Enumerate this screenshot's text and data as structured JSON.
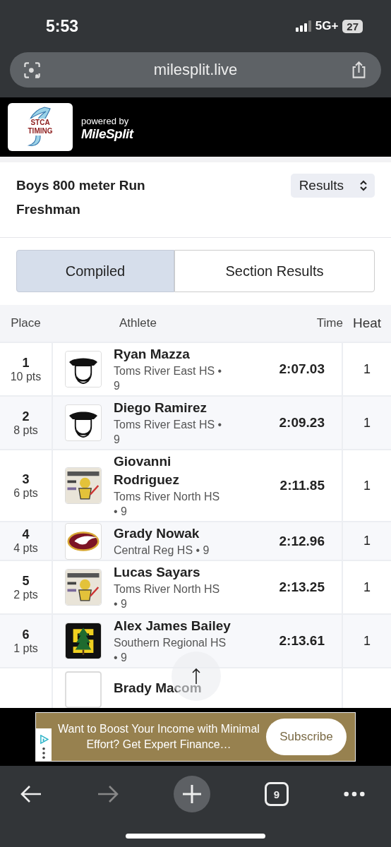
{
  "status_bar": {
    "time": "5:53",
    "network": "5G+",
    "battery": "27"
  },
  "browser": {
    "url": "milesplit.live",
    "tab_count": "9"
  },
  "header": {
    "logo_text": [
      "STCA",
      "TIMING"
    ],
    "powered_by": "powered by",
    "brand": "MileSplit"
  },
  "event": {
    "title": "Boys 800 meter Run",
    "subtitle": "Freshman",
    "view_select": "Results"
  },
  "tabs": [
    {
      "label": "Compiled",
      "selected": true
    },
    {
      "label": "Section Results",
      "selected": false
    }
  ],
  "table": {
    "columns": [
      "Place",
      "Athlete",
      "Time",
      "Heat"
    ],
    "rows": [
      {
        "place": "1",
        "points": "10 pts",
        "logo": {
          "kind": "pirate"
        },
        "name": "Ryan Mazza",
        "team": "Toms River East HS •",
        "grade": "9",
        "time": "2:07.03",
        "heat": "1"
      },
      {
        "place": "2",
        "points": "8 pts",
        "logo": {
          "kind": "pirate"
        },
        "name": "Diego Ramirez",
        "team": "Toms River East HS •",
        "grade": "9",
        "time": "2:09.23",
        "heat": "1"
      },
      {
        "place": "3",
        "points": "6 pts",
        "logo": {
          "kind": "north"
        },
        "name": "Giovanni Rodriguez",
        "team": "Toms River North HS",
        "grade": "• 9",
        "time": "2:11.85",
        "heat": "1"
      },
      {
        "place": "4",
        "points": "4 pts",
        "logo": {
          "kind": "eagle"
        },
        "name": "Grady Nowak",
        "team": "Central Reg HS • 9",
        "time": "2:12.96",
        "heat": "1"
      },
      {
        "place": "5",
        "points": "2 pts",
        "logo": {
          "kind": "north"
        },
        "name": "Lucas Sayars",
        "team": "Toms River North HS",
        "grade": "• 9",
        "time": "2:13.25",
        "heat": "1"
      },
      {
        "place": "6",
        "points": "1 pts",
        "logo": {
          "kind": "tree"
        },
        "name": "Alex James Bailey",
        "team": "Southern Regional HS",
        "grade": "• 9",
        "time": "2:13.61",
        "heat": "1"
      },
      {
        "logo": {
          "kind": "blank"
        },
        "name": "Brady Macom"
      }
    ]
  },
  "ad": {
    "text": "Want to Boost Your Income with Minimal Effort? Get Expert Finance…",
    "button": "Subscribe"
  }
}
